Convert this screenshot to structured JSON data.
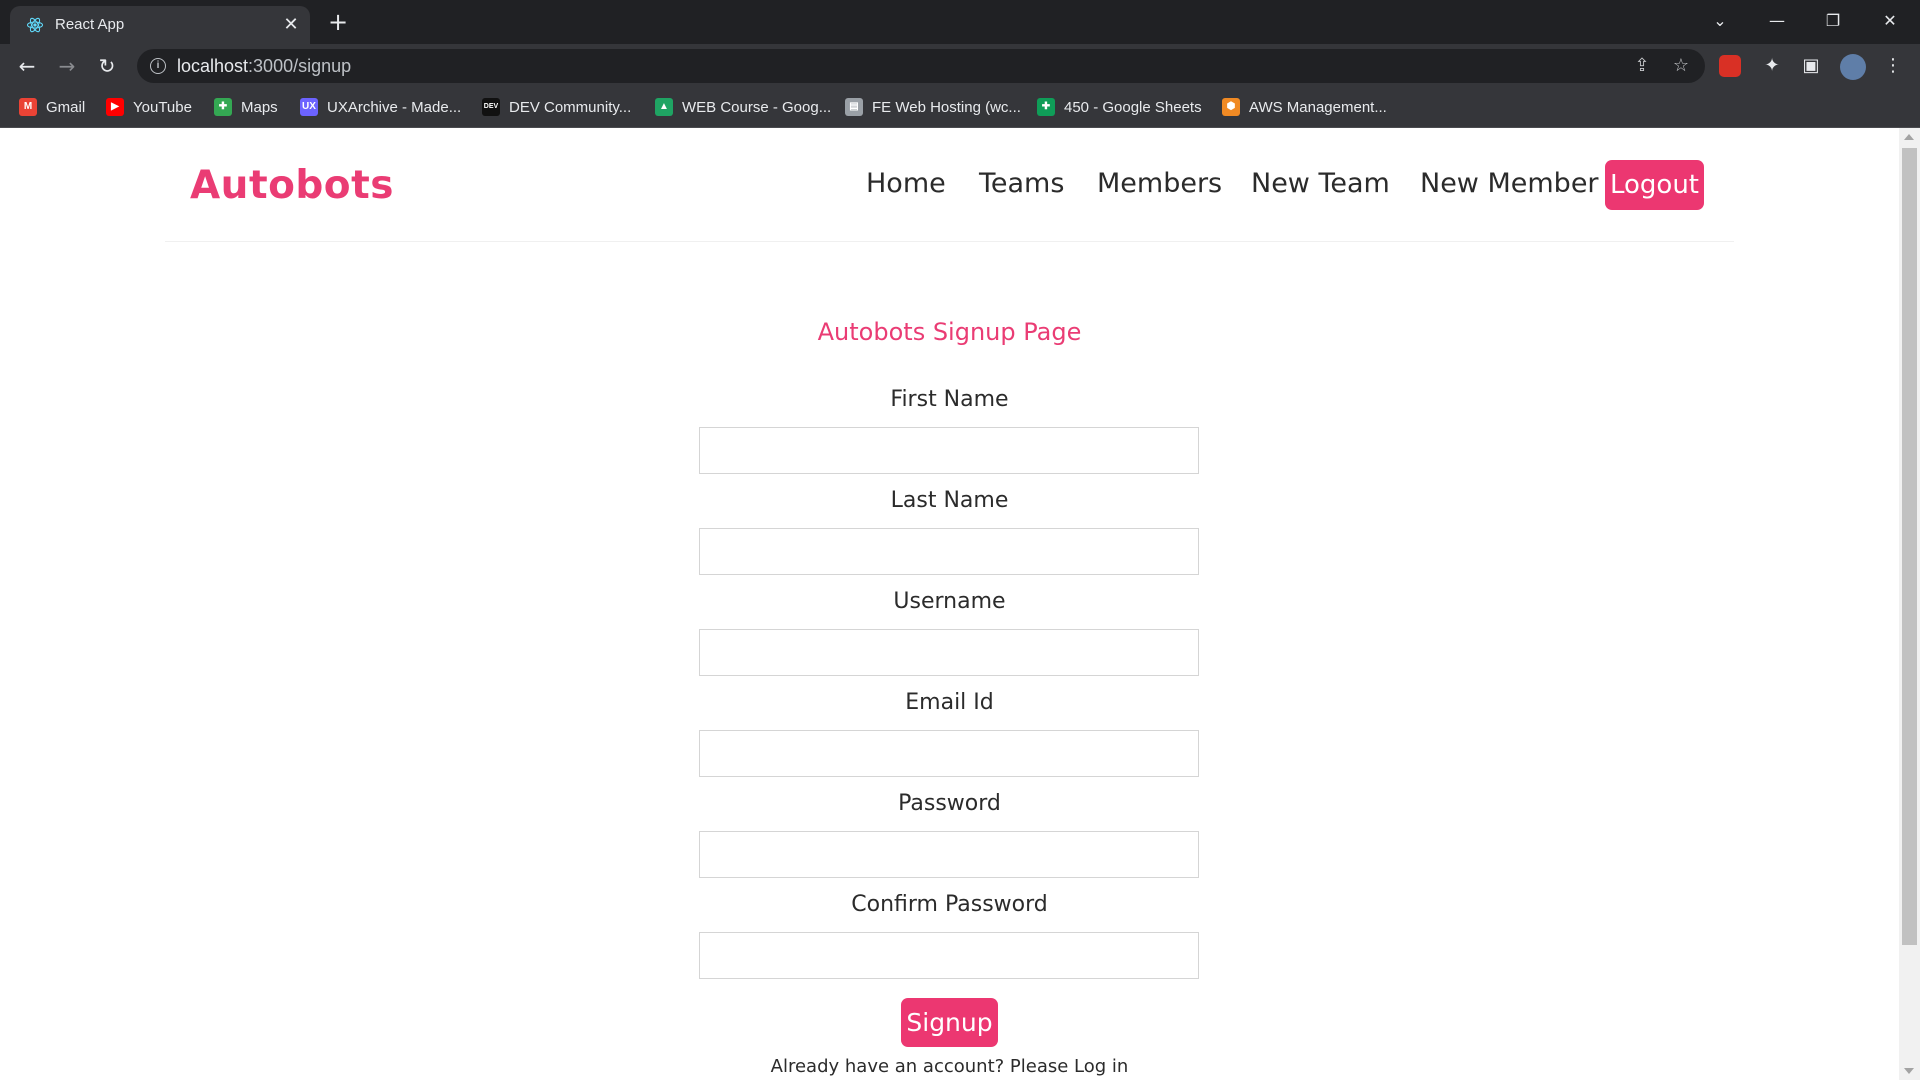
{
  "browser": {
    "tab_title": "React App",
    "tab_close": "✕",
    "new_tab": "+",
    "url_host": "localhost",
    "url_path": ":3000/signup",
    "window_controls": {
      "dropdown": "⌄",
      "minimize": "—",
      "restore": "❐",
      "close": "✕"
    },
    "nav": {
      "back": "←",
      "forward": "→",
      "reload": "↻"
    },
    "omnibox_icons": {
      "share": "⇪",
      "star": "☆"
    },
    "extension_icons": {
      "puzzle": "✦",
      "sidepanel": "▣",
      "menu": "⋮"
    },
    "bookmarks": [
      {
        "label": "Gmail",
        "icon": "gmail-icon",
        "glyph": "M",
        "color": "#ea4335"
      },
      {
        "label": "YouTube",
        "icon": "youtube-icon",
        "glyph": "▶",
        "color": "#ff0000"
      },
      {
        "label": "Maps",
        "icon": "maps-icon",
        "glyph": "✚",
        "color": "#34a853"
      },
      {
        "label": "UXArchive - Made...",
        "icon": "uxarchive-icon",
        "glyph": "UX",
        "color": "#6c63ff"
      },
      {
        "label": "DEV Community...",
        "icon": "dev-icon",
        "glyph": "DEV",
        "color": "#111111"
      },
      {
        "label": "WEB Course - Goog...",
        "icon": "drive-icon",
        "glyph": "▲",
        "color": "#1fa463"
      },
      {
        "label": "FE Web Hosting (wc...",
        "icon": "page-icon",
        "glyph": "▤",
        "color": "#9aa0a6"
      },
      {
        "label": "450 - Google Sheets",
        "icon": "sheets-icon",
        "glyph": "✚",
        "color": "#0f9d58"
      },
      {
        "label": "AWS Management...",
        "icon": "aws-icon",
        "glyph": "⬢",
        "color": "#f08a24"
      }
    ]
  },
  "app": {
    "brand": "Autobots",
    "nav_links": [
      "Home",
      "Teams",
      "Members",
      "New Team",
      "New Member"
    ],
    "logout_label": "Logout",
    "accent_color": "#ea3c74"
  },
  "signup": {
    "title": "Autobots Signup Page",
    "fields": [
      {
        "label": "First Name",
        "value": ""
      },
      {
        "label": "Last Name",
        "value": ""
      },
      {
        "label": "Username",
        "value": ""
      },
      {
        "label": "Email Id",
        "value": ""
      },
      {
        "label": "Password",
        "value": ""
      },
      {
        "label": "Confirm Password",
        "value": ""
      }
    ],
    "submit_label": "Signup",
    "login_hint": "Already have an account? Please Log in"
  }
}
